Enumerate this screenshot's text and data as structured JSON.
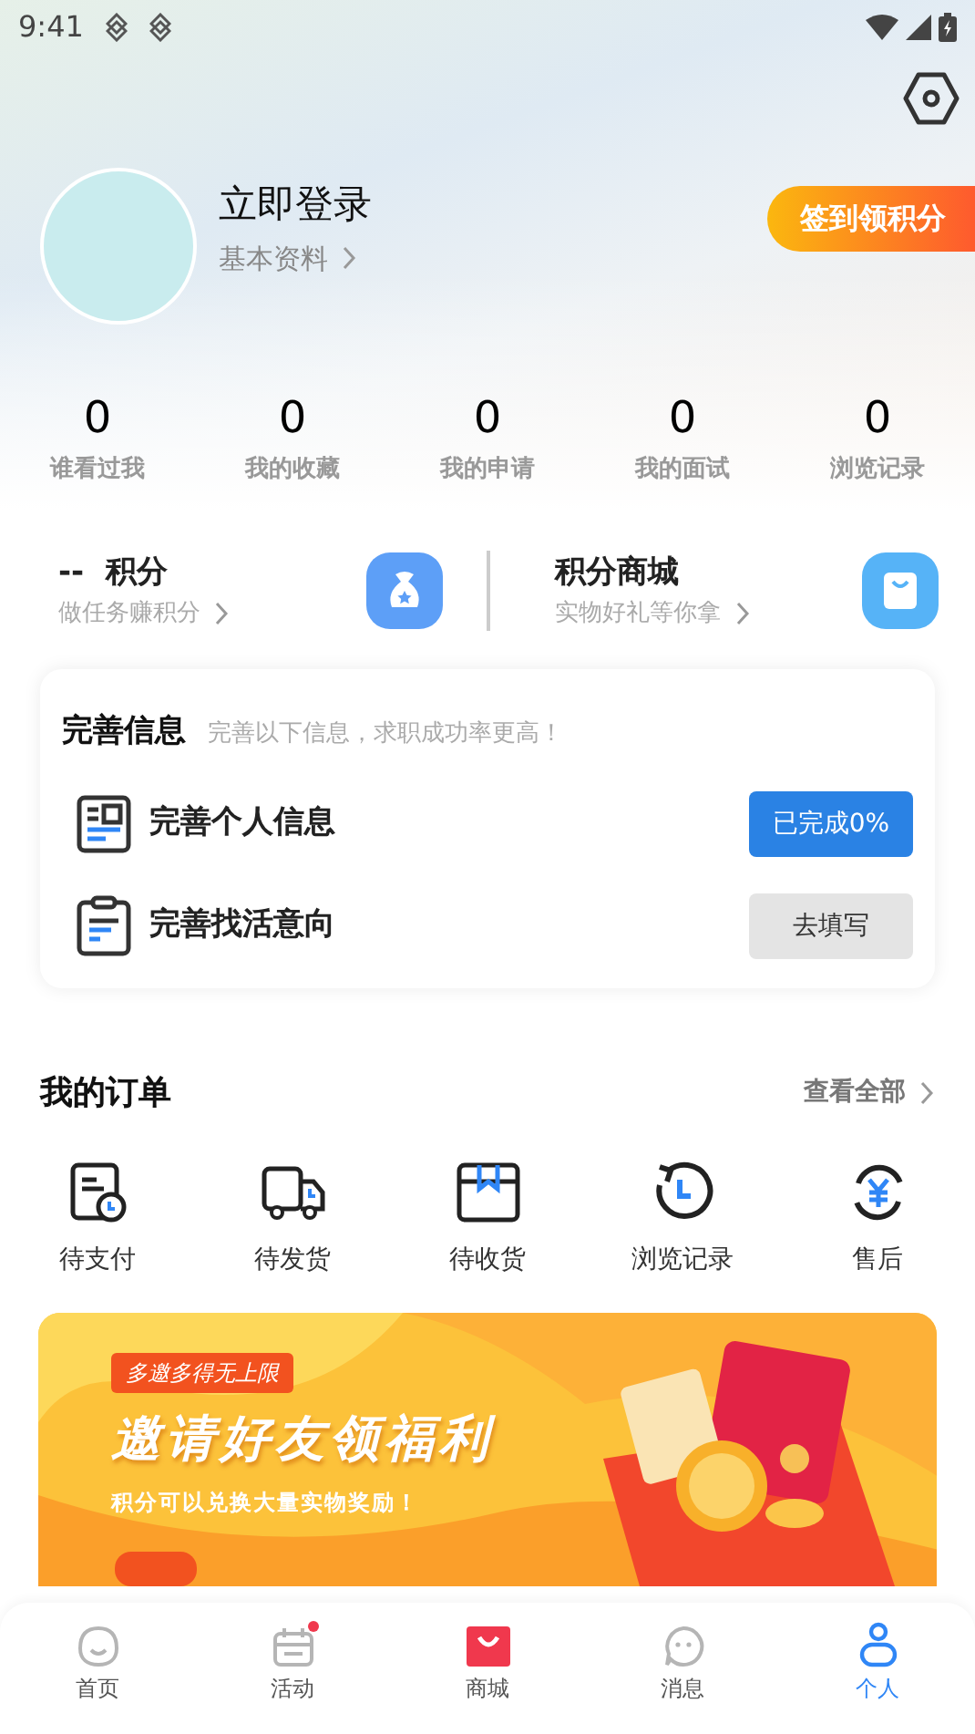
{
  "status_bar": {
    "time": "9:41"
  },
  "profile": {
    "name": "立即登录",
    "link": "基本资料"
  },
  "checkin_button": "签到领积分",
  "stats": [
    {
      "value": "0",
      "label": "谁看过我"
    },
    {
      "value": "0",
      "label": "我的收藏"
    },
    {
      "value": "0",
      "label": "我的申请"
    },
    {
      "value": "0",
      "label": "我的面试"
    },
    {
      "value": "0",
      "label": "浏览记录"
    }
  ],
  "points": [
    {
      "title": "--  积分",
      "subtitle": "做任务赚积分",
      "kind": "bag"
    },
    {
      "title": "积分商城",
      "subtitle": "实物好礼等你拿",
      "kind": "shop"
    }
  ],
  "complete_info": {
    "title": "完善信息",
    "hint": "完善以下信息，求职成功率更高！",
    "items": [
      {
        "label": "完善个人信息",
        "action": "已完成0%",
        "kind": "profile",
        "primary": true
      },
      {
        "label": "完善找活意向",
        "action": "去填写",
        "kind": "intent",
        "primary": false
      }
    ]
  },
  "orders": {
    "title": "我的订单",
    "view_all": "查看全部",
    "items": [
      {
        "label": "待支付",
        "kind": "pay"
      },
      {
        "label": "待发货",
        "kind": "ship"
      },
      {
        "label": "待收货",
        "kind": "receive"
      },
      {
        "label": "浏览记录",
        "kind": "history"
      },
      {
        "label": "售后",
        "kind": "aftersale"
      }
    ]
  },
  "banner": {
    "tag": "多邀多得无上限",
    "title": "邀请好友领福利",
    "subtitle": "积分可以兑换大量实物奖励！"
  },
  "tab_bar": [
    {
      "label": "首页",
      "kind": "home",
      "selected": false,
      "dot": false
    },
    {
      "label": "活动",
      "kind": "event",
      "selected": false,
      "dot": true
    },
    {
      "label": "商城",
      "kind": "shop",
      "selected": false,
      "dot": false
    },
    {
      "label": "消息",
      "kind": "message",
      "selected": false,
      "dot": false
    },
    {
      "label": "个人",
      "kind": "person",
      "selected": true,
      "dot": false
    }
  ]
}
